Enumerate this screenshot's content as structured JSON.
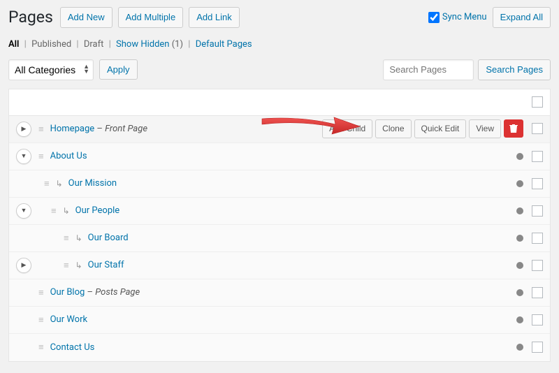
{
  "header": {
    "title": "Pages",
    "add_new": "Add New",
    "add_multiple": "Add Multiple",
    "add_link": "Add Link",
    "sync_menu": "Sync Menu",
    "expand_all": "Expand All"
  },
  "filters": {
    "all": "All",
    "published": "Published",
    "draft": "Draft",
    "show_hidden": "Show Hidden",
    "hidden_count": "(1)",
    "default_pages": "Default Pages"
  },
  "toolbar": {
    "category_select": "All Categories",
    "apply": "Apply",
    "search_placeholder": "Search Pages",
    "search_button": "Search Pages"
  },
  "actions": {
    "add_child": "Add Child",
    "clone": "Clone",
    "quick_edit": "Quick Edit",
    "view": "View"
  },
  "pages": {
    "homepage": {
      "title": "Homepage",
      "suffix": "Front Page"
    },
    "about_us": {
      "title": "About Us"
    },
    "our_mission": {
      "title": "Our Mission"
    },
    "our_people": {
      "title": "Our People"
    },
    "our_board": {
      "title": "Our Board"
    },
    "our_staff": {
      "title": "Our Staff"
    },
    "our_blog": {
      "title": "Our Blog",
      "suffix": "Posts Page"
    },
    "our_work": {
      "title": "Our Work"
    },
    "contact_us": {
      "title": "Contact Us"
    }
  },
  "annotation_color": "#e53935"
}
